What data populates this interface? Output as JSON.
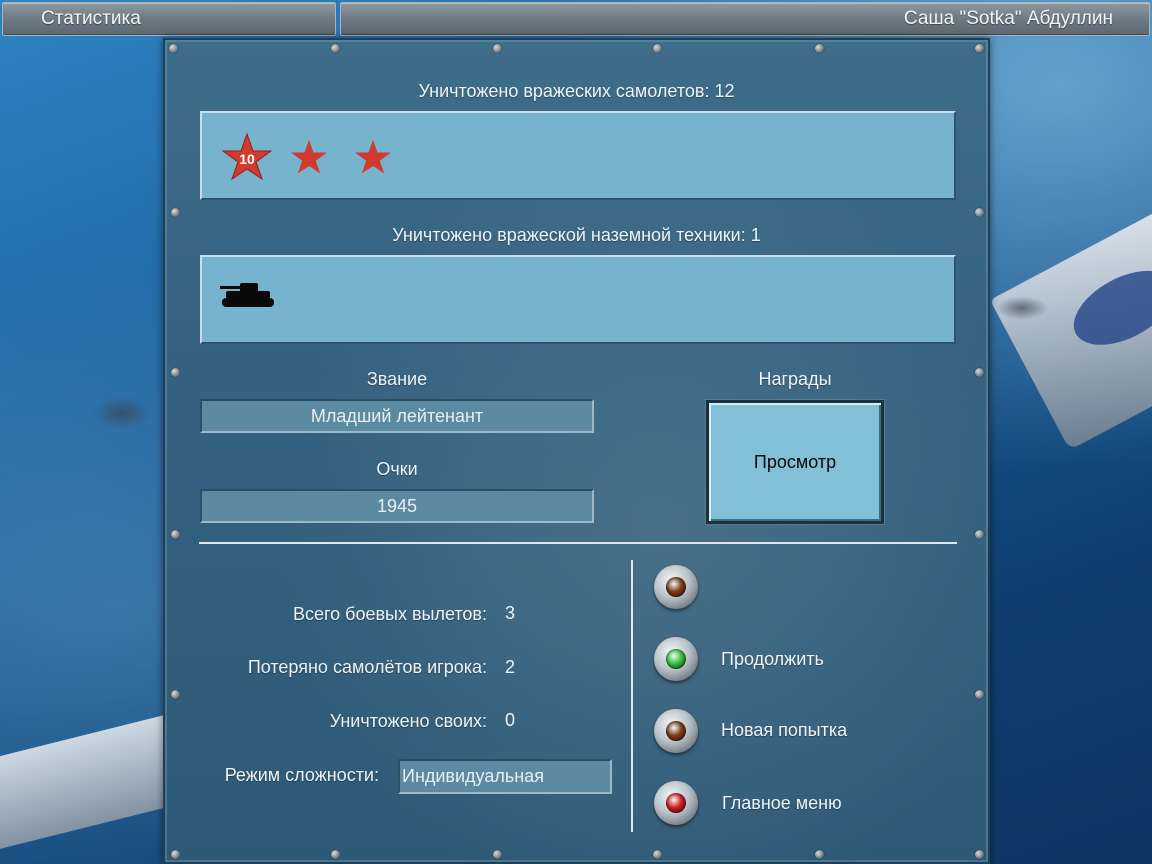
{
  "header": {
    "screen_title": "Статистика",
    "player_name": "Саша \"Sotka\" Абдуллин"
  },
  "kills": {
    "air_label": "Уничтожено вражеских самолетов: 12",
    "air_badge_number": "10",
    "ground_label": "Уничтожено вражеской наземной техники: 1"
  },
  "rank": {
    "label": "Звание",
    "value": "Младший лейтенант"
  },
  "score": {
    "label": "Очки",
    "value": "1945"
  },
  "awards": {
    "label": "Награды",
    "view_button": "Просмотр"
  },
  "stats": {
    "sorties_label": "Всего боевых вылетов:",
    "sorties_value": "3",
    "lost_label": "Потеряно самолётов игрока:",
    "lost_value": "2",
    "friendly_label": "Уничтожено своих:",
    "friendly_value": "0",
    "difficulty_label": "Режим сложности:",
    "difficulty_value": "Индивидуальная"
  },
  "menu": {
    "items": [
      {
        "label": "",
        "lamp_color": "#7a3a14",
        "icon": "knob-icon"
      },
      {
        "label": "Продолжить",
        "lamp_color": "#2fc13a",
        "icon": "knob-icon"
      },
      {
        "label": "Новая попытка",
        "lamp_color": "#7a3a14",
        "icon": "knob-icon"
      },
      {
        "label": "Главное меню",
        "lamp_color": "#d0191b",
        "icon": "knob-icon"
      }
    ]
  },
  "colors": {
    "star_red": "#d23a2e",
    "tank_black": "#0a0a0a"
  }
}
